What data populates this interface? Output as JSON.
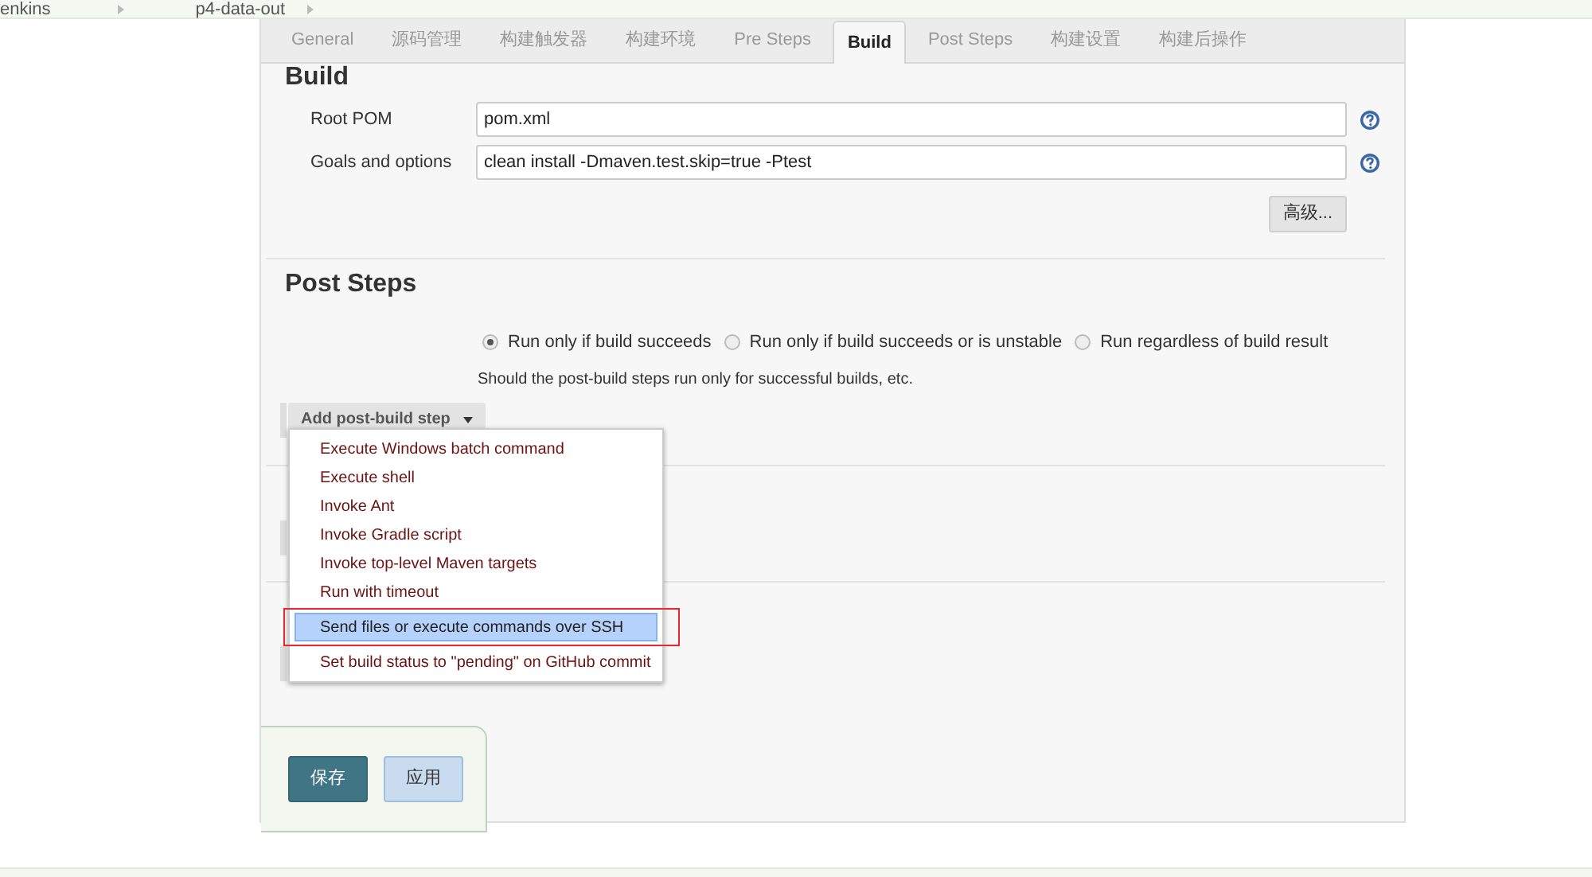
{
  "breadcrumbs": [
    "enkins",
    "p4-data-out"
  ],
  "tabs": [
    {
      "label": "General",
      "selected": false
    },
    {
      "label": "源码管理",
      "selected": false
    },
    {
      "label": "构建触发器",
      "selected": false
    },
    {
      "label": "构建环境",
      "selected": false
    },
    {
      "label": "Pre Steps",
      "selected": false
    },
    {
      "label": "Build",
      "selected": true
    },
    {
      "label": "Post Steps",
      "selected": false
    },
    {
      "label": "构建设置",
      "selected": false
    },
    {
      "label": "构建后操作",
      "selected": false
    }
  ],
  "build": {
    "title": "Build",
    "fields": [
      {
        "label": "Root POM",
        "value": "pom.xml"
      },
      {
        "label": "Goals and options",
        "value": "clean install -Dmaven.test.skip=true -Ptest"
      }
    ],
    "advanced_button": "高级..."
  },
  "post_steps": {
    "title": "Post Steps",
    "options": [
      {
        "label": "Run only if build succeeds",
        "selected": true
      },
      {
        "label": "Run only if build succeeds or is unstable",
        "selected": false
      },
      {
        "label": "Run regardless of build result",
        "selected": false
      }
    ],
    "help": "Should the post-build steps run only for successful builds, etc.",
    "add_button": "Add post-build step",
    "menu": [
      {
        "label": "Execute Windows batch command",
        "selected": false,
        "annotated": false
      },
      {
        "label": "Execute shell",
        "selected": false,
        "annotated": false
      },
      {
        "label": "Invoke Ant",
        "selected": false,
        "annotated": false
      },
      {
        "label": "Invoke Gradle script",
        "selected": false,
        "annotated": false
      },
      {
        "label": "Invoke top-level Maven targets",
        "selected": false,
        "annotated": false
      },
      {
        "label": "Run with timeout",
        "selected": false,
        "annotated": false
      },
      {
        "label": "Send files or execute commands over SSH",
        "selected": true,
        "annotated": true
      },
      {
        "label": "Set build status to \"pending\" on GitHub commit",
        "selected": false,
        "annotated": false
      }
    ]
  },
  "footer_buttons": [
    {
      "label": "保存",
      "kind": "primary"
    },
    {
      "label": "应用",
      "kind": "secondary"
    }
  ]
}
